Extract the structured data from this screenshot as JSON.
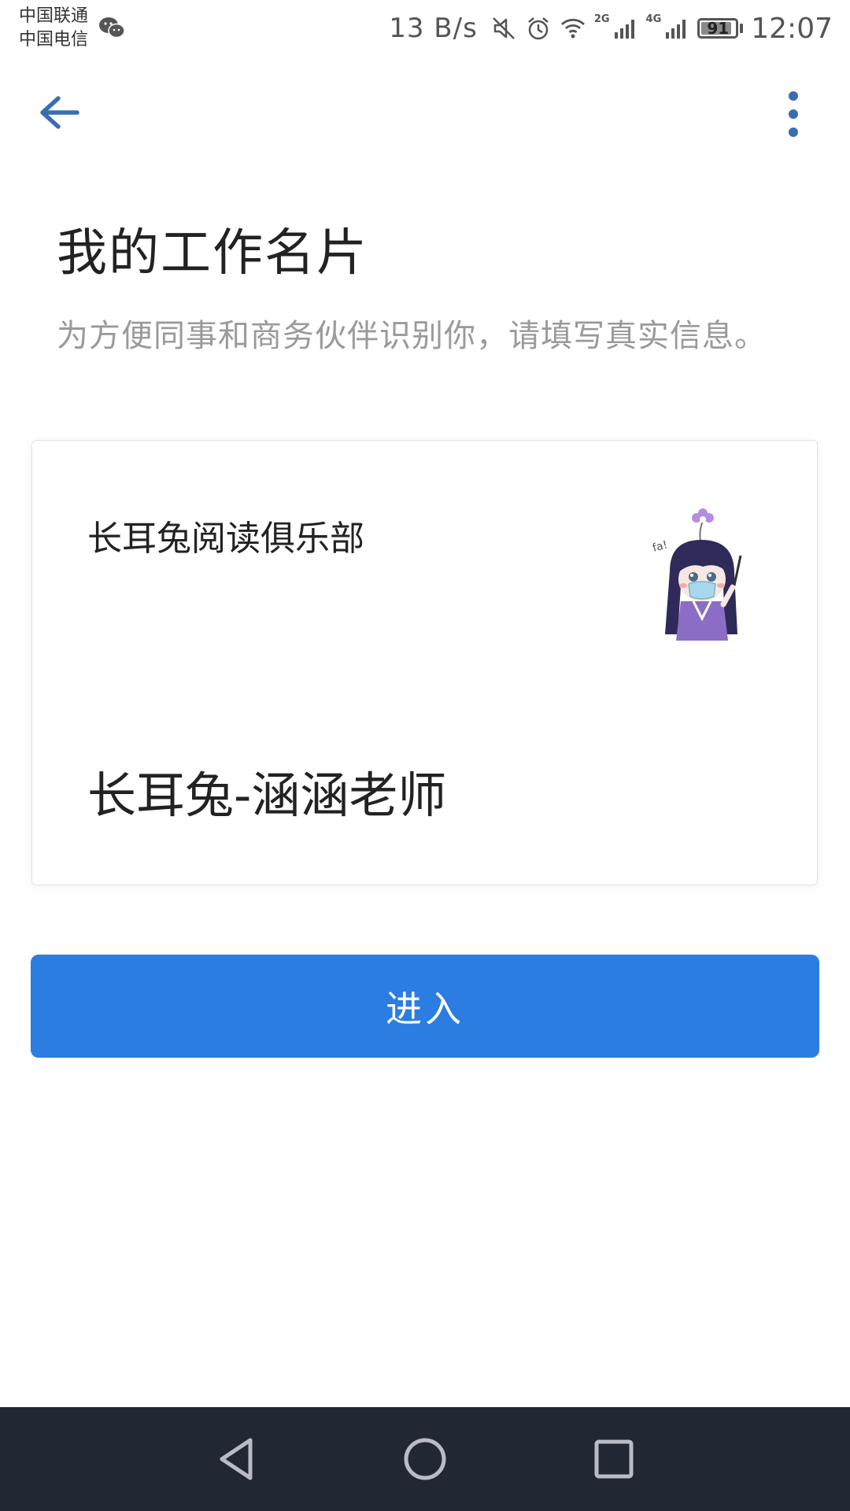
{
  "status_bar": {
    "carrier_1": "中国联通",
    "carrier_2": "中国电信",
    "net_speed": "13 B/s",
    "signal_1_label": "2G",
    "signal_2_label": "4G",
    "battery": "91",
    "battery_level": 0.91,
    "time": "12:07"
  },
  "icons": {
    "back": "arrow-left",
    "more": "more-vertical",
    "wechat": "wechat",
    "mute": "volume-mute",
    "alarm": "alarm",
    "wifi": "wifi",
    "nav_back": "triangle-back",
    "nav_home": "circle-home",
    "nav_recent": "square-recent"
  },
  "page": {
    "title": "我的工作名片",
    "subtitle": "为方便同事和商务伙伴识别你，请填写真实信息。"
  },
  "card": {
    "company": "长耳兔阅读俱乐部",
    "name": "长耳兔-涵涵老师"
  },
  "actions": {
    "enter_label": "进入"
  },
  "colors": {
    "primary": "#2b7de1",
    "back_icon": "#3a6db0",
    "nav_bar": "#222734"
  }
}
